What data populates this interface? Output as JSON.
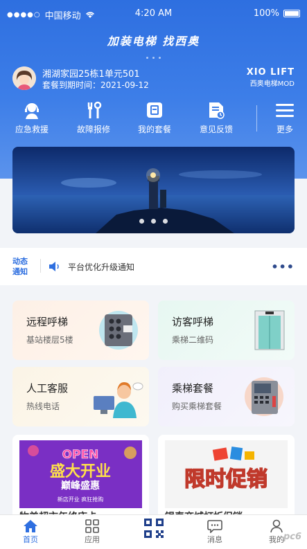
{
  "status_bar": {
    "signal_dots": "●●●●○",
    "carrier": "中国移动",
    "time": "4:20 AM",
    "battery": "100%"
  },
  "hero": {
    "slogan": "加装电梯 找西奥"
  },
  "user": {
    "community": "湘湖家园25栋1单元501",
    "expire": "套餐到期时间：2021-09-12"
  },
  "brand": {
    "name": "XIO LIFT",
    "sub": "西奥电梯MOD"
  },
  "quick_actions": [
    {
      "label": "应急救援",
      "icon": "emergency-agent-icon"
    },
    {
      "label": "故障报修",
      "icon": "repair-tools-icon"
    },
    {
      "label": "我的套餐",
      "icon": "package-icon"
    },
    {
      "label": "意见反馈",
      "icon": "feedback-icon"
    },
    {
      "label": "更多",
      "icon": "menu-icon"
    }
  ],
  "notice": {
    "tag_line1": "动态",
    "tag_line2": "通知",
    "text": "平台优化升级通知",
    "more": "•••"
  },
  "services": [
    {
      "title": "远程呼梯",
      "subtitle": "基站楼层5楼",
      "icon": "elevator-panel-icon"
    },
    {
      "title": "访客呼梯",
      "subtitle": "乘梯二维码",
      "icon": "elevator-door-icon"
    },
    {
      "title": "人工客服",
      "subtitle": "热线电话",
      "icon": "customer-service-icon"
    },
    {
      "title": "乘梯套餐",
      "subtitle": "购买乘梯套餐",
      "icon": "ticket-machine-icon"
    }
  ],
  "promos": [
    {
      "caption": "物美超市年终庆卡",
      "img_line1": "OPEN",
      "img_line2": "盛大开业",
      "img_line3": "巅峰盛惠",
      "img_line4": "新店开业 疯狂抢购"
    },
    {
      "caption": "银泰商城打折促销",
      "img_line1": "限时促销"
    }
  ],
  "tabs": [
    {
      "label": "首页",
      "icon": "home-icon",
      "active": true
    },
    {
      "label": "应用",
      "icon": "apps-icon"
    },
    {
      "label": "",
      "icon": "qr-code-icon"
    },
    {
      "label": "消息",
      "icon": "message-icon"
    },
    {
      "label": "我的",
      "icon": "profile-icon"
    }
  ],
  "watermark": "pc6"
}
